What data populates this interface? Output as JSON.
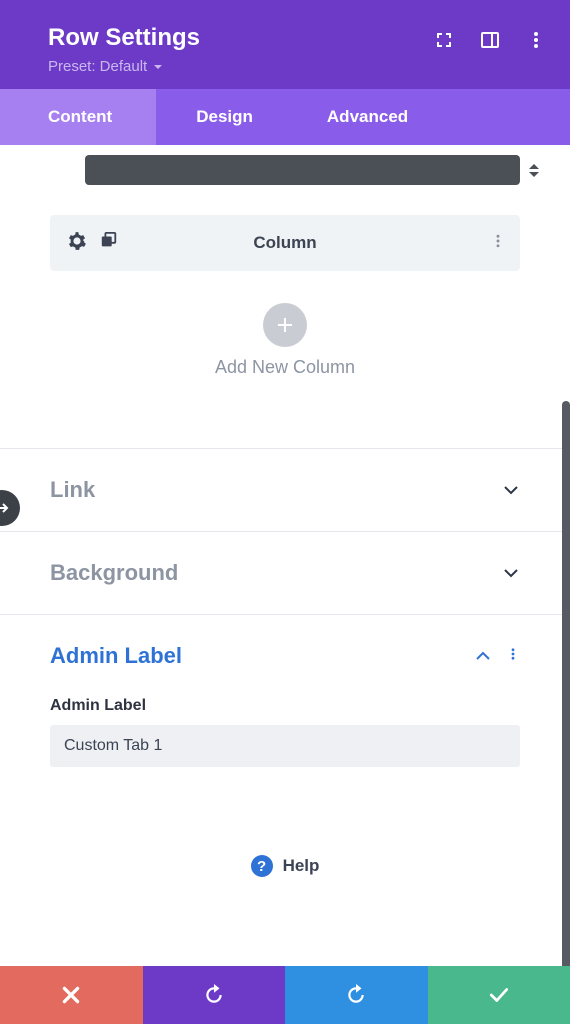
{
  "header": {
    "title": "Row Settings",
    "preset": "Preset: Default"
  },
  "tabs": {
    "content": "Content",
    "design": "Design",
    "advanced": "Advanced"
  },
  "column": {
    "label": "Column"
  },
  "add_column": {
    "label": "Add New Column"
  },
  "sections": {
    "link": "Link",
    "background": "Background",
    "admin_label": "Admin Label"
  },
  "admin": {
    "field_label": "Admin Label",
    "value": "Custom Tab 1"
  },
  "help": {
    "label": "Help"
  }
}
